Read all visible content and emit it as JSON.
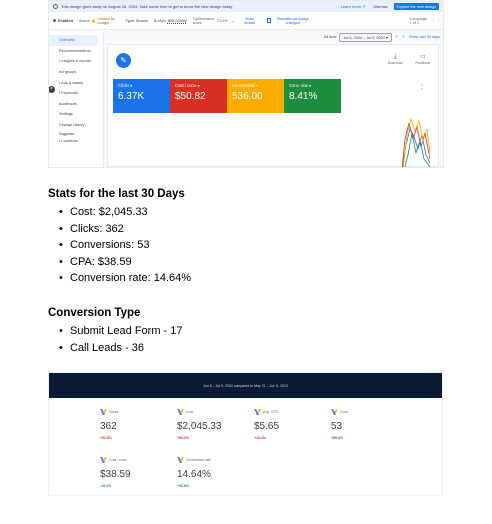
{
  "ads": {
    "banner": {
      "message": "This design goes away on August 26, 2024. Take some time to get to know the new design today",
      "learn_more": "Learn more ↗",
      "dismiss": "Dismiss",
      "explore": "Explore the new design"
    },
    "campaign": {
      "name": "Enabled",
      "status_label": "Status",
      "status_value": "Limited by budget",
      "type_label": "Type: Search",
      "budget_label": "Budget",
      "budget_value": "$68.00/day",
      "optimization_label": "Optimization score",
      "optimization_value": "73.4%",
      "more_details": "More details",
      "simulate": "Simulate campaign changes",
      "count": "Campaign 1 of 1"
    },
    "sidebar": [
      {
        "label": "Overview",
        "active": true
      },
      {
        "label": "Recommendations"
      },
      {
        "label": "• Insights & reports"
      },
      {
        "label": "Ad groups"
      },
      {
        "label": "• Ads & assets"
      },
      {
        "label": "• Keywords"
      },
      {
        "label": "Audiences"
      },
      {
        "label": "Settings"
      },
      {
        "label": "Change history"
      },
      {
        "label": "Suggested",
        "section": true
      },
      {
        "label": "• Locations"
      }
    ],
    "date_range": {
      "label": "All time",
      "value": "Jul 6, 2024 – Jul 5, 2024",
      "show_last": "Show last 30 days"
    },
    "tools": {
      "download": "Download",
      "feedback": "Feedback"
    },
    "tiles": [
      {
        "label": "Clicks",
        "value": "6.37K",
        "color": "#1a73e8"
      },
      {
        "label": "Cost / conv.",
        "value": "$50.82",
        "color": "#d93025"
      },
      {
        "label": "Conversions",
        "value": "536.00",
        "color": "#f9ab00"
      },
      {
        "label": "Conv. rate",
        "value": "8.41%",
        "color": "#1e8e3e"
      }
    ]
  },
  "stats": {
    "heading": "Stats for the last 30 Days",
    "items": [
      "Cost: $2,045.33",
      "Clicks: 362",
      "Conversions: 53",
      "CPA: $38.59",
      "Conversion rate: 14.64%"
    ]
  },
  "conversion_type": {
    "heading": "Conversion Type",
    "items": [
      "Submit Lead Form - 17",
      "Call Leads - 36"
    ]
  },
  "dashboard": {
    "header": "Jun 6 – Jul 5, 2024 compared to May 21 – Jun 5, 2024",
    "metrics": [
      {
        "label": "Clicks",
        "value": "362",
        "delta": "+32.8%",
        "delta_color": "#d93025"
      },
      {
        "label": "Cost",
        "value": "$2,045.33",
        "delta": "+53.2%",
        "delta_color": "#d93025"
      },
      {
        "label": "Avg. CPC",
        "value": "$5.65",
        "delta": "+15.4%",
        "delta_color": "#d93025"
      },
      {
        "label": "Conv.",
        "value": "53",
        "delta": "+89.3%",
        "delta_color": "#1e8e3e"
      },
      {
        "label": "Cost / conv.",
        "value": "$38.59",
        "delta": "-19.1%",
        "delta_color": "#1e8e3e"
      },
      {
        "label": "Conversion rate",
        "value": "14.64%",
        "delta": "+42.6%",
        "delta_color": "#1e8e3e"
      }
    ]
  }
}
